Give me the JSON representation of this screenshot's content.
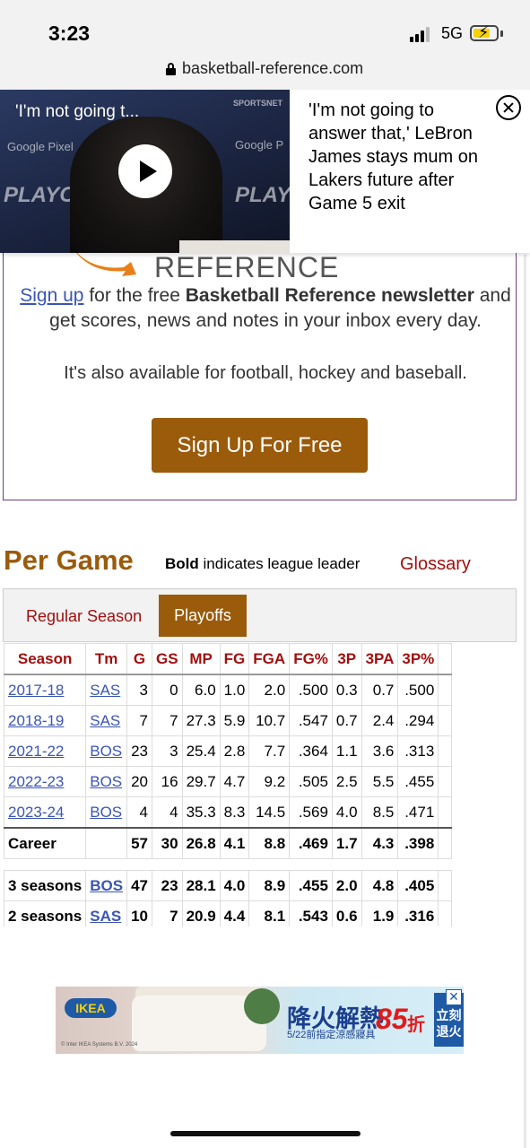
{
  "status_bar": {
    "time": "3:23",
    "network": "5G"
  },
  "browser": {
    "url": "basketball-reference.com"
  },
  "video": {
    "caption": "'I'm not going t...",
    "headline": "'I'm not going to answer that,' LeBron James stays mum on Lakers future after Game 5 exit"
  },
  "newsletter": {
    "logo_text": "REFERENCE",
    "signup_link": "Sign up",
    "text_mid": " for the free ",
    "text_bold": "Basketball Reference newsletter",
    "text_end": " and get scores, news and notes in your inbox every day.",
    "text2": "It's also available for football, hockey and baseball.",
    "button": "Sign Up For Free"
  },
  "per_game": {
    "title": "Per Game",
    "note_bold": "Bold",
    "note_rest": " indicates league leader",
    "glossary": "Glossary",
    "tabs": [
      "Regular Season",
      "Playoffs"
    ],
    "active_tab": "Playoffs",
    "columns": [
      "Season",
      "Tm",
      "G",
      "GS",
      "MP",
      "FG",
      "FGA",
      "FG%",
      "3P",
      "3PA",
      "3P%"
    ],
    "rows": [
      [
        "2017-18",
        "SAS",
        "3",
        "0",
        "6.0",
        "1.0",
        "2.0",
        ".500",
        "0.3",
        "0.7",
        ".500"
      ],
      [
        "2018-19",
        "SAS",
        "7",
        "7",
        "27.3",
        "5.9",
        "10.7",
        ".547",
        "0.7",
        "2.4",
        ".294"
      ],
      [
        "2021-22",
        "BOS",
        "23",
        "3",
        "25.4",
        "2.8",
        "7.7",
        ".364",
        "1.1",
        "3.6",
        ".313"
      ],
      [
        "2022-23",
        "BOS",
        "20",
        "16",
        "29.7",
        "4.7",
        "9.2",
        ".505",
        "2.5",
        "5.5",
        ".455"
      ],
      [
        "2023-24",
        "BOS",
        "4",
        "4",
        "35.3",
        "8.3",
        "14.5",
        ".569",
        "4.0",
        "8.5",
        ".471"
      ]
    ],
    "career": [
      "Career",
      "",
      "57",
      "30",
      "26.8",
      "4.1",
      "8.8",
      ".469",
      "1.7",
      "4.3",
      ".398"
    ],
    "splits": [
      [
        "3 seasons",
        "BOS",
        "47",
        "23",
        "28.1",
        "4.0",
        "8.9",
        ".455",
        "2.0",
        "4.8",
        ".405"
      ],
      [
        "2 seasons",
        "SAS",
        "10",
        "7",
        "20.9",
        "4.4",
        "8.1",
        ".543",
        "0.6",
        "1.9",
        ".316"
      ]
    ]
  },
  "ad": {
    "brand": "IKEA",
    "headline": "降火解熱",
    "discount": "85",
    "discount_suffix": "折",
    "sub": "5/22前指定涼感寢具",
    "side": "立刻 退火",
    "copyright": "© Inter IKEA Systems B.V. 2024"
  },
  "colors": {
    "accent": "#9a5b0b",
    "link": "#3a55b4",
    "header_red": "#a10f0f"
  }
}
